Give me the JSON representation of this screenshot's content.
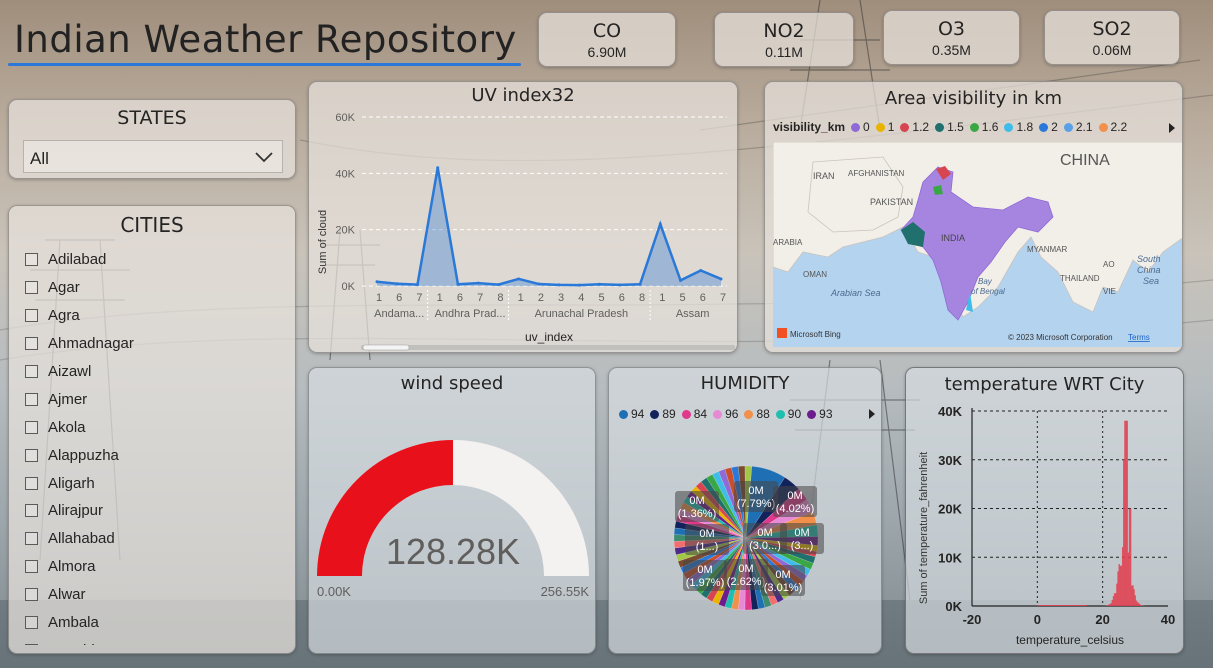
{
  "header": {
    "title": "Indian Weather Repository"
  },
  "kpis": [
    {
      "label": "CO",
      "value": "6.90M"
    },
    {
      "label": "NO2",
      "value": "0.11M"
    },
    {
      "label": "O3",
      "value": "0.35M"
    },
    {
      "label": "SO2",
      "value": "0.06M"
    }
  ],
  "states": {
    "title": "STATES",
    "selected": "All"
  },
  "cities": {
    "title": "CITIES",
    "items": [
      "Adilabad",
      "Agar",
      "Agra",
      "Ahmadnagar",
      "Aizawl",
      "Ajmer",
      "Akola",
      "Alappuzha",
      "Aligarh",
      "Alirajpur",
      "Allahabad",
      "Almora",
      "Alwar",
      "Ambala",
      "Amethi"
    ]
  },
  "uv_chart": {
    "title": "UV index32",
    "xlabel": "uv_index",
    "ylabel": "Sum of cloud",
    "y_ticks": [
      "60K",
      "40K",
      "20K",
      "0K"
    ],
    "x_ticks": [
      "1",
      "6",
      "7",
      "1",
      "6",
      "7",
      "8",
      "1",
      "2",
      "3",
      "4",
      "5",
      "6",
      "8",
      "1",
      "5",
      "6",
      "7"
    ],
    "groups": [
      "Andama...",
      "Andhra Prad...",
      "Arunachal Pradesh",
      "Assam"
    ]
  },
  "map": {
    "title": "Area visibility in km",
    "legend_title": "visibility_km",
    "legend": [
      {
        "label": "0",
        "color": "#8e6ad6"
      },
      {
        "label": "1",
        "color": "#e8b400"
      },
      {
        "label": "1.2",
        "color": "#d64550"
      },
      {
        "label": "1.5",
        "color": "#20706e"
      },
      {
        "label": "1.6",
        "color": "#3aa745"
      },
      {
        "label": "1.8",
        "color": "#3fbde8"
      },
      {
        "label": "2",
        "color": "#2a78d7"
      },
      {
        "label": "2.1",
        "color": "#5aa0e6"
      },
      {
        "label": "2.2",
        "color": "#f0904a"
      }
    ],
    "labels": {
      "china": "CHINA",
      "iran": "IRAN",
      "afghanistan": "AFGHANISTAN",
      "pakistan": "PAKISTAN",
      "india": "INDIA",
      "myanmar": "MYANMAR",
      "thailand": "THAILAND",
      "arabia": "ARABIA",
      "oman": "OMAN",
      "arabian_sea": "Arabian Sea",
      "bay": "Bay",
      "of_bengal": "of Bengal",
      "south": "South",
      "china_sea_1": "China",
      "china_sea_2": "Sea",
      "vie": "VIE",
      "ao": "AO"
    },
    "bing": "Microsoft Bing",
    "copyright": "© 2023 Microsoft Corporation",
    "terms": "Terms"
  },
  "wind": {
    "title": "wind speed",
    "value": "128.28K",
    "min": "0.00K",
    "max": "256.55K",
    "fraction": 0.5
  },
  "humidity": {
    "title": "HUMIDITY",
    "legend": [
      {
        "label": "94",
        "color": "#1f6fb5"
      },
      {
        "label": "89",
        "color": "#12235b"
      },
      {
        "label": "84",
        "color": "#e0398b"
      },
      {
        "label": "96",
        "color": "#e68ad6"
      },
      {
        "label": "88",
        "color": "#f0904a"
      },
      {
        "label": "90",
        "color": "#1fbfb0"
      },
      {
        "label": "93",
        "color": "#6c1c8c"
      }
    ],
    "slice_labels": [
      {
        "v": "0M",
        "p": "(7.79%)"
      },
      {
        "v": "0M",
        "p": "(4.02%)"
      },
      {
        "v": "0M",
        "p": "(1.36%)"
      },
      {
        "v": "0M",
        "p": "(1...)"
      },
      {
        "v": "0M",
        "p": "(3.0...)"
      },
      {
        "v": "0M",
        "p": "(3...)"
      },
      {
        "v": "0M",
        "p": "(1.97%)"
      },
      {
        "v": "0M",
        "p": "(2.62%)"
      },
      {
        "v": "0M",
        "p": "(3.01%)"
      }
    ]
  },
  "temperature": {
    "title": "temperature WRT City",
    "xlabel": "temperature_celsius",
    "ylabel": "Sum of temperature_fahrenheit",
    "y_ticks": [
      "40K",
      "30K",
      "20K",
      "10K",
      "0K"
    ],
    "x_ticks": [
      "-20",
      "0",
      "20",
      "40"
    ]
  },
  "chart_data": [
    {
      "type": "area",
      "title": "UV index32",
      "xlabel": "uv_index",
      "ylabel": "Sum of cloud",
      "ylim": [
        0,
        60000
      ],
      "categories": [
        "1",
        "6",
        "7",
        "1",
        "6",
        "7",
        "8",
        "1",
        "2",
        "3",
        "4",
        "5",
        "6",
        "8",
        "1",
        "5",
        "6",
        "7"
      ],
      "groups": [
        "Andama...",
        "Andhra Prad...",
        "Arunachal Pradesh",
        "Assam"
      ],
      "values": [
        1500,
        800,
        500,
        42000,
        600,
        1000,
        500,
        2500,
        700,
        400,
        300,
        600,
        400,
        600,
        22000,
        2000,
        5500,
        2500
      ]
    },
    {
      "type": "gauge",
      "title": "wind speed",
      "value": 128280,
      "min": 0,
      "max": 256550
    },
    {
      "type": "pie",
      "title": "HUMIDITY",
      "legend": [
        "94",
        "89",
        "84",
        "96",
        "88",
        "90",
        "93"
      ]
    },
    {
      "type": "bar",
      "title": "temperature WRT City",
      "xlabel": "temperature_celsius",
      "ylabel": "Sum of temperature_fahrenheit",
      "xlim": [
        -20,
        40
      ],
      "ylim": [
        0,
        40000
      ]
    }
  ]
}
